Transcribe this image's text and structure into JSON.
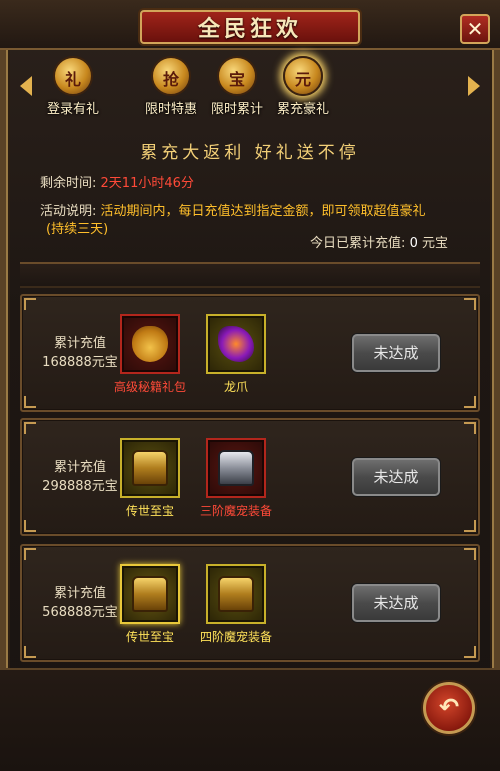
{
  "window": {
    "title": "全民狂欢",
    "close_label": "✕"
  },
  "tabs": [
    {
      "label": "登录有礼",
      "icon": "gift-bag-icon",
      "glyph": "礼"
    },
    {
      "label": "限时特惠",
      "icon": "grab-badge-icon",
      "glyph": "抢"
    },
    {
      "label": "限时累计",
      "icon": "treasure-box-icon",
      "glyph": "宝"
    },
    {
      "label": "累充豪礼",
      "icon": "gold-ingot-icon",
      "glyph": "元"
    }
  ],
  "selected_tab": 3,
  "slogan": "累充大返利    好礼送不停",
  "remaining": {
    "label": "剩余时间:",
    "value": "2天11小时46分"
  },
  "description": {
    "label": "活动说明:",
    "value": "活动期间内，每日充值达到指定金额，即可领取超值豪礼",
    "value_wrap": "(持续三天)"
  },
  "today": {
    "label": "今日已累计充值:",
    "value": "0",
    "unit": "元宝"
  },
  "rows": [
    {
      "requirement_label": "累计充值",
      "requirement_value": "168888元宝",
      "items": [
        {
          "name": "高级秘籍礼包",
          "frame": "red",
          "icon": "treasure-bag-icon",
          "name_color": "red"
        },
        {
          "name": "龙爪",
          "frame": "gold",
          "icon": "dragon-claw-icon",
          "name_color": "yellow"
        }
      ],
      "status": "未达成"
    },
    {
      "requirement_label": "累计充值",
      "requirement_value": "298888元宝",
      "items": [
        {
          "name": "传世至宝",
          "frame": "gold",
          "icon": "gold-chest-icon",
          "name_color": "yellow"
        },
        {
          "name": "三阶魔宠装备",
          "frame": "red",
          "icon": "silver-chest-icon",
          "name_color": "red"
        }
      ],
      "status": "未达成"
    },
    {
      "requirement_label": "累计充值",
      "requirement_value": "568888元宝",
      "items": [
        {
          "name": "传世至宝",
          "frame": "gold-glow",
          "icon": "gold-chest-icon",
          "name_color": "yellow"
        },
        {
          "name": "四阶魔宠装备",
          "frame": "gold",
          "icon": "gold-chest-icon",
          "name_color": "yellow"
        }
      ],
      "status": "未达成"
    }
  ],
  "back_label": "↶"
}
